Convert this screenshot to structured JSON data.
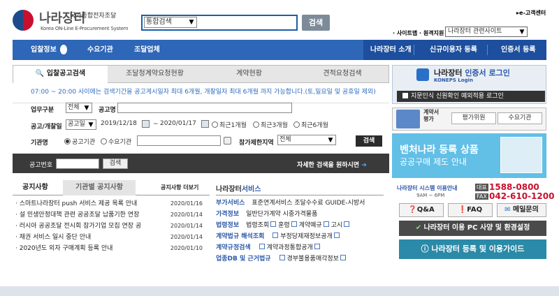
{
  "header": {
    "logo_title": "나라장터",
    "logo_sub": "국가종합전자조달",
    "logo_en": "Korea ON-Line E-Procurement System",
    "search_select": "통합검색",
    "search_button": "검색",
    "cs_link": "▸e-고객센터",
    "util_links": "· 사이트맵 · 원격지원",
    "related_select": "나라장터 관련사이트"
  },
  "nav": {
    "items": [
      "입찰정보",
      "수요기관",
      "조달업체"
    ],
    "right_items": [
      "나라장터 소개",
      "신규이용자 등록",
      "인증서 등록"
    ]
  },
  "search_panel": {
    "tabs": [
      "입찰공고검색",
      "조달청계약요청현황",
      "계약현황",
      "견적요청검색"
    ],
    "notice": "07:00 ~ 20:00 사이에는 검색기간을 공고게시일자 최대 6개월, 개찰일자 최대 6개월 까지 가능합니다.(토,일요일 및 공휴일 제외)",
    "biz_type_label": "업무구분",
    "biz_type_value": "전체",
    "bid_name_label": "공고명",
    "date_label": "공고/개찰일",
    "date_type": "공고일",
    "date_from": "2019/12/18",
    "date_tilde": "~",
    "date_to": "2020/01/17",
    "period_opts": [
      "최근1개월",
      "최근3개월",
      "최근6개월"
    ],
    "org_label": "기관명",
    "org_opts": [
      "공고기관",
      "수요기관"
    ],
    "region_label": "참가제한지역",
    "region_value": "전체",
    "search_button": "검색",
    "bid_no_label": "공고번호",
    "bid_no_button": "검색",
    "detail_link": "자세한 검색을 원하시면"
  },
  "notices": {
    "tab1": "공지사항",
    "tab2": "기관별 공지사항",
    "more": "공지사항 더보기",
    "items": [
      {
        "title": "스마트나라장터 push 서비스 제공 목록 안내",
        "date": "2020/01/16"
      },
      {
        "title": "설 민생안정대책 관련 공공조달 납품기한 연장",
        "date": "2020/01/14"
      },
      {
        "title": "러시아 공공조달 전시회 참가기업 모집 연장 공",
        "date": "2020/01/14"
      },
      {
        "title": "채권 서비스 일시 중단 안내",
        "date": "2020/01/14"
      },
      {
        "title": "2020년도 외자 구매계획 등록 안내",
        "date": "2020/01/10"
      }
    ]
  },
  "services": {
    "title_a": "나라장터",
    "title_b": "서비스",
    "rows": [
      {
        "k": "부가서비스",
        "v": [
          "표준연계서비스  조달수수료  GUIDE-시방서"
        ]
      },
      {
        "k": "가격정보",
        "v": [
          "일반단가계약  시중가격물품"
        ]
      },
      {
        "k": "법령정보",
        "v": [
          "법령조회",
          "훈령",
          "계약예규",
          "고시"
        ]
      },
      {
        "k": "계약법규 해석조회",
        "v": [
          "부정당제재정보공개"
        ]
      },
      {
        "k": "계약규정검색",
        "v": [
          "계약과정통합공개"
        ]
      },
      {
        "k": "업종DB 및 근거법규",
        "v": [
          "경부불용품매각정보"
        ]
      }
    ]
  },
  "right": {
    "login_title_a": "나라장터 ",
    "login_title_b": "인증서 로그인",
    "login_sub": "KONEPS Login",
    "cert_link": "지문인식 신원확인 예외적용 로그인",
    "eval_title": "계약서\n평가",
    "eval_btn1": "평가위원",
    "eval_btn2": "수요기관",
    "banner_t1": "벤처나라 등록 상품",
    "banner_t2": "공공구매 제도 안내",
    "call_sys": "나라장터 시스템 이용안내",
    "call_time": "9AM ~ 6PM",
    "call_tel": "대표",
    "call_num1": "1588-0800",
    "call_fax": "FAX",
    "call_num2": "042-610-1200",
    "qa": "Q&A",
    "faq": "FAQ",
    "mail": "메일문의",
    "pc_btn": "나라장터 이용 PC 사양 및 환경설정",
    "guide_btn": "나라장터 등록 및 이용가이드"
  },
  "colors": {
    "brand_blue": "#2e66b8",
    "dark_blue": "#1d4f9e",
    "red": "#c8102e",
    "banner": "#62bfe6"
  }
}
